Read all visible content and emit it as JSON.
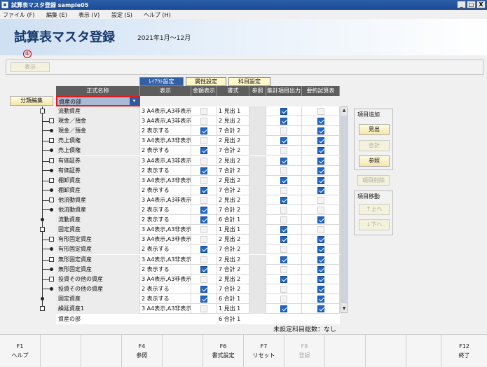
{
  "window": {
    "title": "試算表マスタ登録 sample05",
    "min": "_",
    "max": "□",
    "close": "X"
  },
  "menu": [
    "ファイル (F)",
    "編集 (E)",
    "表示 (V)",
    "設定 (S)",
    "ヘルプ (H)"
  ],
  "header": {
    "title": "試算表マスタ登録",
    "period": "2021年1月～12月"
  },
  "marker": "①",
  "toolbar": {
    "display_button": "表示"
  },
  "tabs": [
    "ﾚｲｱｳﾄ設定",
    "属性設定",
    "科目設定"
  ],
  "left": {
    "classify_button": "分類編集"
  },
  "columns": [
    "正式名称",
    "表示",
    "金額表示",
    "書式",
    "参照",
    "集計項目出力",
    "要約試算表"
  ],
  "combo": {
    "value": "資産の部",
    "arrow": "▾"
  },
  "rows": [
    {
      "name": "流動資産",
      "disp": "3 A4表示,A3非表示",
      "amt": false,
      "fmt": "1 見出 1",
      "agg": true,
      "sum": false
    },
    {
      "name": "現金／預金",
      "disp": "3 A4表示,A3非表示",
      "amt": false,
      "fmt": "2 見出 2",
      "agg": true,
      "sum": true
    },
    {
      "name": "現金／預金",
      "disp": "2 表示する",
      "amt": true,
      "fmt": "7 合計 2",
      "agg": false,
      "sum": true
    },
    {
      "name": "売上債権",
      "disp": "3 A4表示,A3非表示",
      "amt": false,
      "fmt": "2 見出 2",
      "agg": true,
      "sum": true
    },
    {
      "name": "売上債権",
      "disp": "2 表示する",
      "amt": true,
      "fmt": "7 合計 2",
      "agg": false,
      "sum": true
    },
    {
      "name": "有価証券",
      "disp": "3 A4表示,A3非表示",
      "amt": false,
      "fmt": "2 見出 2",
      "agg": true,
      "sum": true
    },
    {
      "name": "有価証券",
      "disp": "2 表示する",
      "amt": true,
      "fmt": "7 合計 2",
      "agg": false,
      "sum": true
    },
    {
      "name": "棚卸資産",
      "disp": "3 A4表示,A3非表示",
      "amt": false,
      "fmt": "2 見出 2",
      "agg": true,
      "sum": true
    },
    {
      "name": "棚卸資産",
      "disp": "2 表示する",
      "amt": true,
      "fmt": "7 合計 2",
      "agg": false,
      "sum": true
    },
    {
      "name": "他流動資産",
      "disp": "3 A4表示,A3非表示",
      "amt": false,
      "fmt": "2 見出 2",
      "agg": true,
      "sum": false
    },
    {
      "name": "他流動資産",
      "disp": "2 表示する",
      "amt": true,
      "fmt": "7 合計 2",
      "agg": false,
      "sum": false
    },
    {
      "name": "流動資産",
      "disp": "2 表示する",
      "amt": true,
      "fmt": "6 合計 1",
      "agg": false,
      "sum": true
    },
    {
      "name": "固定資産",
      "disp": "3 A4表示,A3非表示",
      "amt": false,
      "fmt": "1 見出 1",
      "agg": true,
      "sum": false
    },
    {
      "name": "有形固定資産",
      "disp": "3 A4表示,A3非表示",
      "amt": false,
      "fmt": "2 見出 2",
      "agg": true,
      "sum": true
    },
    {
      "name": "有形固定資産",
      "disp": "2 表示する",
      "amt": true,
      "fmt": "7 合計 2",
      "agg": false,
      "sum": true
    },
    {
      "name": "無形固定資産",
      "disp": "3 A4表示,A3非表示",
      "amt": false,
      "fmt": "2 見出 2",
      "agg": true,
      "sum": true
    },
    {
      "name": "無形固定資産",
      "disp": "2 表示する",
      "amt": true,
      "fmt": "7 合計 2",
      "agg": false,
      "sum": true
    },
    {
      "name": "投資その他の資産",
      "disp": "3 A4表示,A3非表示",
      "amt": false,
      "fmt": "2 見出 2",
      "agg": true,
      "sum": true
    },
    {
      "name": "投資その他の資産",
      "disp": "2 表示する",
      "amt": true,
      "fmt": "7 合計 2",
      "agg": false,
      "sum": true
    },
    {
      "name": "固定資産",
      "disp": "2 表示する",
      "amt": true,
      "fmt": "6 合計 1",
      "agg": false,
      "sum": true
    },
    {
      "name": "繰延資産1",
      "disp": "3 A4表示,A3非表示",
      "amt": false,
      "fmt": "1 見出 1",
      "agg": true,
      "sum": true
    }
  ],
  "footer_row": {
    "name": "資産の部",
    "fmt": "6 合計 1"
  },
  "side": {
    "add_title": "項目追加",
    "heading_btn": "見出",
    "total_btn": "合計",
    "ref_btn": "参照",
    "delete_btn": "項目削除",
    "move_title": "項目移動",
    "up_btn": "↑上へ",
    "down_btn": "↓下へ"
  },
  "unset_label": "未設定科目総数：なし",
  "fkeys": [
    {
      "key": "F1",
      "label": "ヘルプ",
      "enabled": true
    },
    {
      "key": "F4",
      "label": "参照",
      "enabled": true
    },
    {
      "key": "F6",
      "label": "書式設定",
      "enabled": true
    },
    {
      "key": "F7",
      "label": "リセット",
      "enabled": true
    },
    {
      "key": "F8",
      "label": "登録",
      "enabled": false
    },
    {
      "key": "F12",
      "label": "終了",
      "enabled": true
    }
  ]
}
